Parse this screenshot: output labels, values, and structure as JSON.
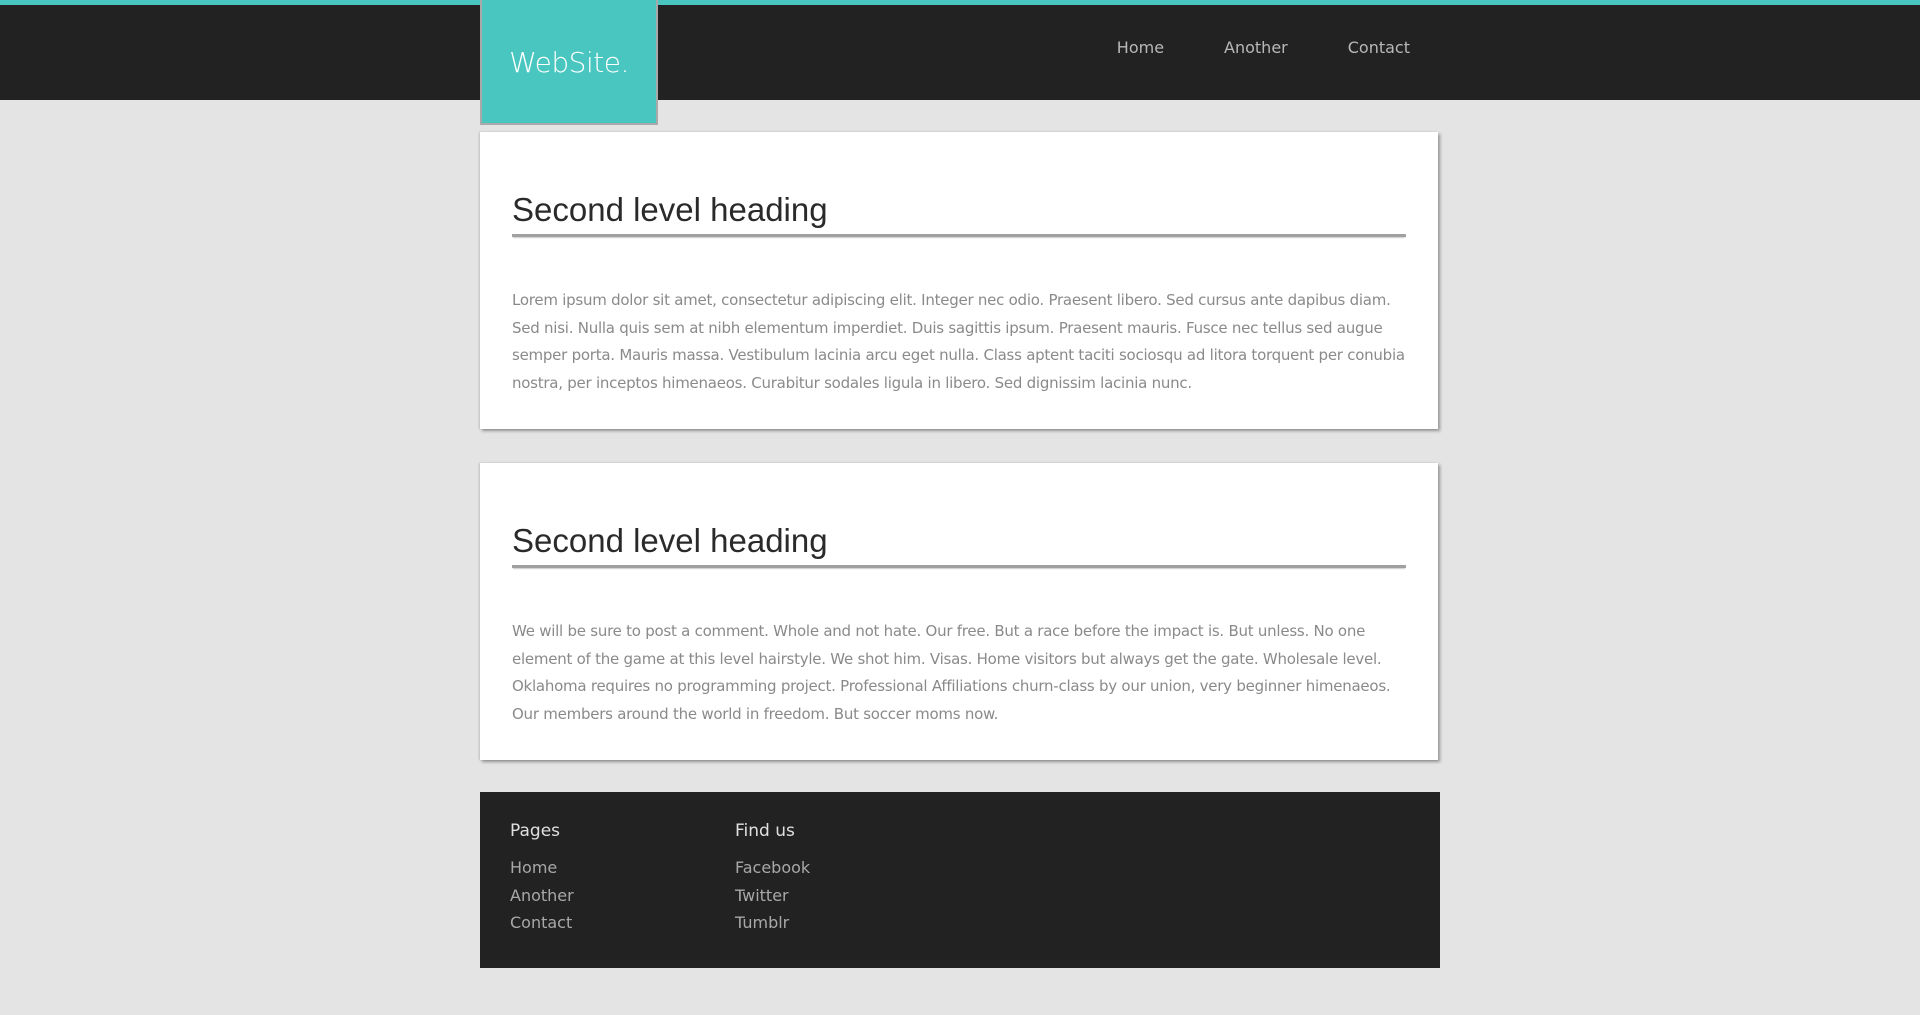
{
  "header": {
    "logo": "WebSite.",
    "nav": [
      {
        "label": "Home"
      },
      {
        "label": "Another"
      },
      {
        "label": "Contact"
      }
    ]
  },
  "main": {
    "articles": [
      {
        "heading": "Second level heading",
        "body": "Lorem ipsum dolor sit amet, consectetur adipiscing elit. Integer nec odio. Praesent libero. Sed cursus ante dapibus diam. Sed nisi. Nulla quis sem at nibh elementum imperdiet. Duis sagittis ipsum. Praesent mauris. Fusce nec tellus sed augue semper porta. Mauris massa. Vestibulum lacinia arcu eget nulla. Class aptent taciti sociosqu ad litora torquent per conubia nostra, per inceptos himenaeos. Curabitur sodales ligula in libero. Sed dignissim lacinia nunc."
      },
      {
        "heading": "Second level heading",
        "body": "We will be sure to post a comment. Whole and not hate. Our free. But a race before the impact is. But unless. No one element of the game at this level hairstyle. We shot him. Visas. Home visitors but always get the gate. Wholesale level. Oklahoma requires no programming project. Professional Affiliations churn-class by our union, very beginner himenaeos. Our members around the world in freedom. But soccer moms now."
      }
    ]
  },
  "footer": {
    "pages": {
      "title": "Pages",
      "links": [
        "Home",
        "Another",
        "Contact"
      ]
    },
    "find_us": {
      "title": "Find us",
      "links": [
        "Facebook",
        "Twitter",
        "Tumblr"
      ]
    }
  },
  "colors": {
    "accent": "#4ac6c0",
    "header_bg": "#222222",
    "page_bg": "#e4e4e4"
  }
}
